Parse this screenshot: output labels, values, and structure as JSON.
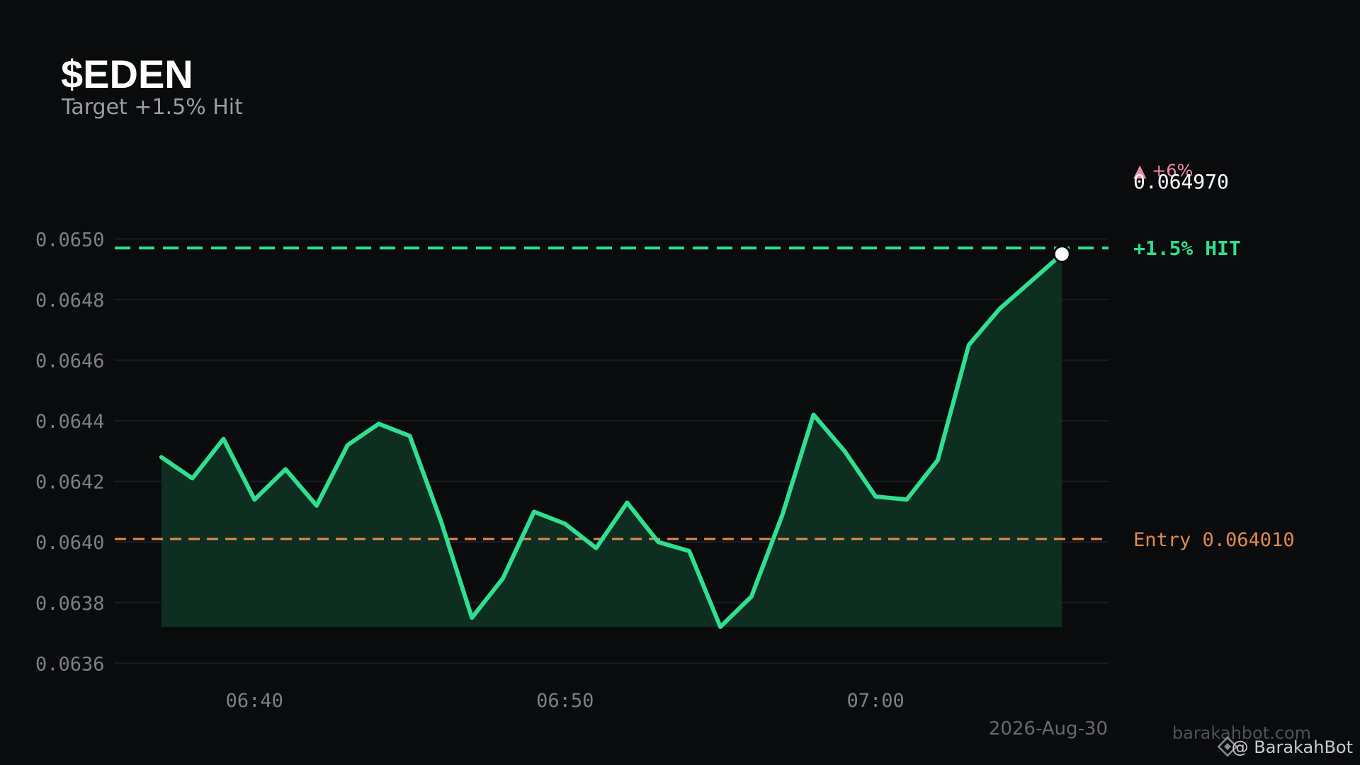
{
  "title": "$EDEN",
  "subtitle": "Target +1.5% Hit",
  "colors": {
    "background": "#0a0b0d",
    "line": "#2ee08f",
    "area": "#0f2e22",
    "target": "#2ee08f",
    "entry": "#e08a4e",
    "change": "#ef8aa3",
    "grid": "#1b1d21",
    "tick": "#7c7f84",
    "dot": "#ffffff"
  },
  "chart_data": {
    "type": "area",
    "x": [
      "06:37:00",
      "06:38:00",
      "06:39:00",
      "06:40:00",
      "06:41:00",
      "06:42:00",
      "06:43:00",
      "06:44:00",
      "06:45:00",
      "06:46:00",
      "06:47:00",
      "06:48:00",
      "06:49:00",
      "06:50:00",
      "06:51:00",
      "06:52:00",
      "06:53:00",
      "06:54:00",
      "06:55:00",
      "06:56:00",
      "06:57:00",
      "06:58:00",
      "06:59:00",
      "07:00:00",
      "07:01:00",
      "07:02:00",
      "07:03:00",
      "07:04:00",
      "07:05:00",
      "07:06:00"
    ],
    "values": [
      0.06428,
      0.06421,
      0.06434,
      0.06414,
      0.06424,
      0.06412,
      0.06432,
      0.06439,
      0.06435,
      0.06407,
      0.06375,
      0.06388,
      0.0641,
      0.06406,
      0.06398,
      0.06413,
      0.064,
      0.06397,
      0.06372,
      0.06382,
      0.06409,
      0.06442,
      0.0643,
      0.06415,
      0.06414,
      0.06427,
      0.06465,
      0.06477,
      0.06486,
      0.06495
    ],
    "y_ticks": [
      "0.0636",
      "0.0638",
      "0.0640",
      "0.0642",
      "0.0644",
      "0.0646",
      "0.0648",
      "0.0650"
    ],
    "y_tick_values": [
      0.0636,
      0.0638,
      0.064,
      0.0642,
      0.0644,
      0.0646,
      0.0648,
      0.065
    ],
    "x_ticks": [
      "06:40",
      "06:50",
      "07:00"
    ],
    "x_tick_values": [
      "06:40:00",
      "06:50:00",
      "07:00:00"
    ],
    "ylim": [
      0.06354,
      0.06519
    ],
    "xlim": [
      "06:35:30",
      "07:07:30"
    ],
    "grid": true,
    "date_label": "2026-Aug-30",
    "target": {
      "value": 0.06497,
      "label": "+1.5%  HIT"
    },
    "entry": {
      "value": 0.06401,
      "label": "Entry 0.064010"
    },
    "last_price": {
      "value": 0.06497,
      "label": "0.064970"
    },
    "change_label": "▲ +6%"
  },
  "watermark": {
    "site": "barakahbot.com",
    "handle": "@ BarakahBot",
    "icon": "binance-diamond-icon"
  }
}
